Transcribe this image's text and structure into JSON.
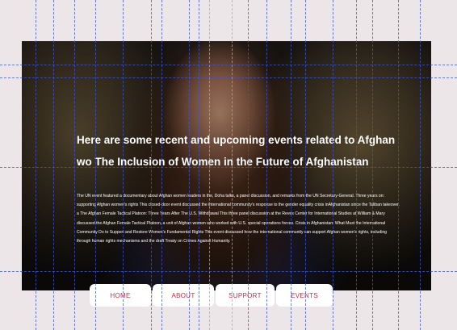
{
  "hero": {
    "title": "Here are some recent and upcoming events related to Afghan wo The Inclusion of Women in the Future of Afghanistan",
    "body": "The UN event featured a documentary about Afghan women leaders in the, Doha talks, a panel discussion, and remarks from the UN Secretary-General. Three years on: supporting Afghan women's rights This closed-door event discussed the international community's response to the gender equality crisis inAfghanistan since the Taliban takeover. a The Afghan Female Tactical Platoon: Three Years After The U.S. Withdrawal This three panel discussion at the Reves Center for International Studies at William & Mary discussed the Afghan Female Tactical Platoon, a unit of Afghan women who worked with U.S. special operations forces. Crisis in Afghanistan: What Must the International Community Do to Support and Restore Women's Fundamental Rights This event discussed how the international community can support Afghan women's rights, including through human rights mechanisms and the draft Treaty on Crimes Against Humanity."
  },
  "nav": {
    "items": [
      {
        "label": "HOME"
      },
      {
        "label": "ABOUT"
      },
      {
        "label": "SUPPORT"
      },
      {
        "label": "EVENTS"
      }
    ]
  },
  "colors": {
    "page_background": "#ece6e8",
    "nav_text": "#d9243b",
    "guide_blue": "#3b57d6",
    "guide_yellow": "#b3c12d"
  }
}
